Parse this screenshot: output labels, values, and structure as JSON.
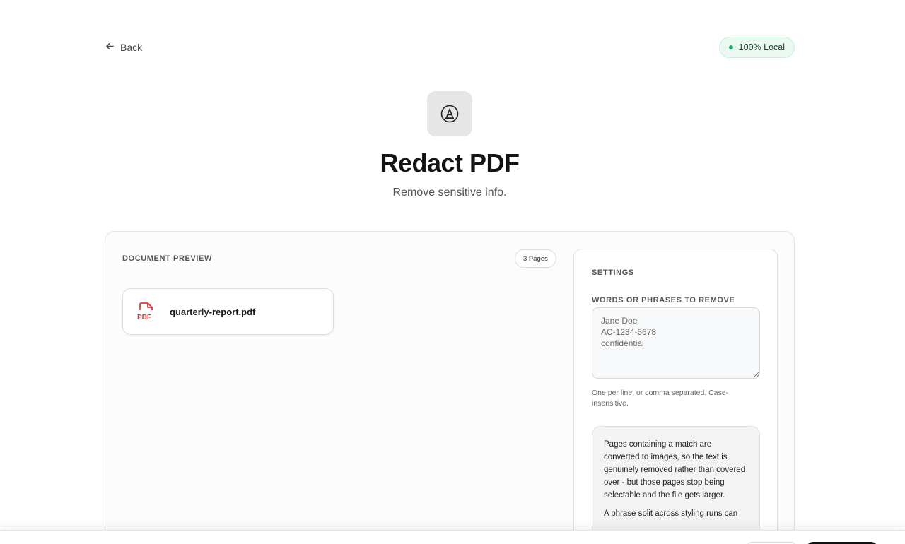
{
  "header": {
    "back_label": "Back",
    "badge_label": "100% Local"
  },
  "tool": {
    "icon": "redact-a-icon",
    "title": "Redact PDF",
    "subtitle": "Remove sensitive info."
  },
  "preview": {
    "label": "Document Preview",
    "pages_badge": "3 Pages",
    "file": {
      "icon": "pdf-file-icon",
      "icon_label": "PDF",
      "name": "quarterly-report.pdf"
    }
  },
  "settings": {
    "title": "Settings",
    "words_label": "Words or phrases to remove",
    "words_value": "Jane Doe\nAC-1234-5678\nconfidential",
    "hint": "One per line, or comma separated. Case-insensitive.",
    "note_paragraphs": [
      "Pages containing a match are converted to images, so the text is genuinely removed rather than covered over - but those pages stop being selectable and the file gets larger.",
      "A phrase split across styling runs can"
    ]
  },
  "colors": {
    "badge_dot": "#16b364",
    "pdf_red": "#e5343a",
    "primary": "#111111"
  }
}
